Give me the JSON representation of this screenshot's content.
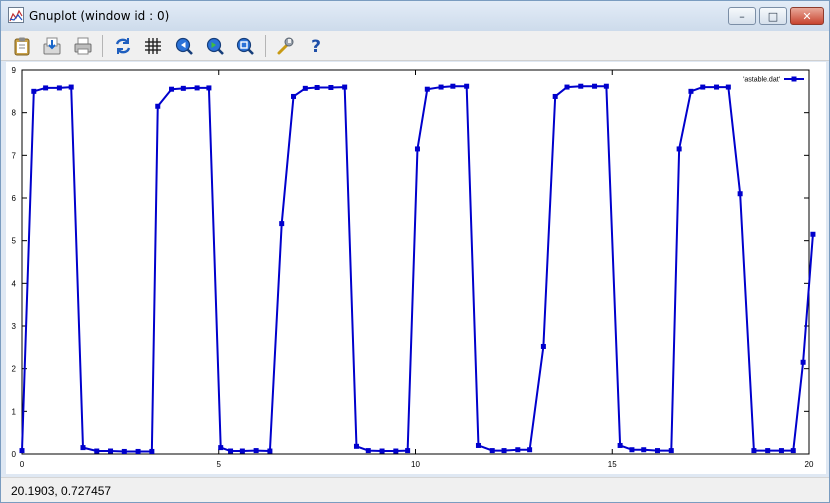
{
  "window": {
    "title": "Gnuplot (window id : 0)",
    "controls": {
      "minimize": "–",
      "maximize": "□",
      "close": "✕"
    }
  },
  "toolbar": {
    "items": [
      {
        "name": "copy-to-clipboard",
        "icon": "clipboard-icon"
      },
      {
        "name": "save",
        "icon": "save-icon"
      },
      {
        "name": "print",
        "icon": "printer-icon"
      },
      {
        "name": "replot",
        "icon": "refresh-icon"
      },
      {
        "name": "grid",
        "icon": "grid-icon"
      },
      {
        "name": "zoom-previous",
        "icon": "zoom-back-icon"
      },
      {
        "name": "zoom-next",
        "icon": "zoom-forward-icon"
      },
      {
        "name": "autoscale",
        "icon": "zoom-fit-icon"
      },
      {
        "name": "options",
        "icon": "wrench-icon"
      },
      {
        "name": "help",
        "icon": "help-icon"
      }
    ]
  },
  "chart_data": {
    "type": "line",
    "xlim": [
      0,
      20
    ],
    "ylim": [
      0,
      9
    ],
    "x_ticks": [
      "0",
      "5",
      "10",
      "15",
      "20"
    ],
    "y_ticks": [
      "0",
      "1",
      "2",
      "3",
      "4",
      "5",
      "6",
      "7",
      "8",
      "9"
    ],
    "grid": false,
    "legend_position": "top-right",
    "series": [
      {
        "name": "'astable.dat'",
        "color": "#0000cc",
        "marker": "square",
        "points": [
          [
            0.0,
            0.08
          ],
          [
            0.3,
            8.5
          ],
          [
            0.6,
            8.58
          ],
          [
            0.95,
            8.58
          ],
          [
            1.25,
            8.6
          ],
          [
            1.55,
            0.15
          ],
          [
            1.9,
            0.07
          ],
          [
            2.25,
            0.07
          ],
          [
            2.6,
            0.06
          ],
          [
            2.95,
            0.06
          ],
          [
            3.3,
            0.06
          ],
          [
            3.45,
            8.15
          ],
          [
            3.8,
            8.55
          ],
          [
            4.1,
            8.57
          ],
          [
            4.45,
            8.58
          ],
          [
            4.75,
            8.58
          ],
          [
            5.05,
            0.15
          ],
          [
            5.3,
            0.07
          ],
          [
            5.6,
            0.07
          ],
          [
            5.95,
            0.08
          ],
          [
            6.3,
            0.07
          ],
          [
            6.6,
            5.4
          ],
          [
            6.9,
            8.38
          ],
          [
            7.2,
            8.57
          ],
          [
            7.5,
            8.59
          ],
          [
            7.85,
            8.59
          ],
          [
            8.2,
            8.6
          ],
          [
            8.5,
            0.18
          ],
          [
            8.8,
            0.08
          ],
          [
            9.15,
            0.07
          ],
          [
            9.5,
            0.07
          ],
          [
            9.8,
            0.08
          ],
          [
            10.05,
            7.15
          ],
          [
            10.3,
            8.55
          ],
          [
            10.65,
            8.6
          ],
          [
            10.95,
            8.62
          ],
          [
            11.3,
            8.62
          ],
          [
            11.6,
            0.2
          ],
          [
            11.95,
            0.08
          ],
          [
            12.25,
            0.08
          ],
          [
            12.6,
            0.1
          ],
          [
            12.9,
            0.1
          ],
          [
            13.25,
            2.52
          ],
          [
            13.55,
            8.38
          ],
          [
            13.85,
            8.6
          ],
          [
            14.2,
            8.62
          ],
          [
            14.55,
            8.62
          ],
          [
            14.85,
            8.62
          ],
          [
            15.2,
            0.2
          ],
          [
            15.5,
            0.1
          ],
          [
            15.8,
            0.1
          ],
          [
            16.15,
            0.08
          ],
          [
            16.5,
            0.08
          ],
          [
            16.7,
            7.15
          ],
          [
            17.0,
            8.5
          ],
          [
            17.3,
            8.6
          ],
          [
            17.65,
            8.6
          ],
          [
            17.95,
            8.6
          ],
          [
            18.25,
            6.1
          ],
          [
            18.6,
            0.08
          ],
          [
            18.95,
            0.08
          ],
          [
            19.3,
            0.08
          ],
          [
            19.6,
            0.08
          ],
          [
            19.85,
            2.15
          ],
          [
            20.1,
            5.15
          ]
        ]
      }
    ]
  },
  "status": {
    "coordinates": "20.1903,  0.727457"
  }
}
